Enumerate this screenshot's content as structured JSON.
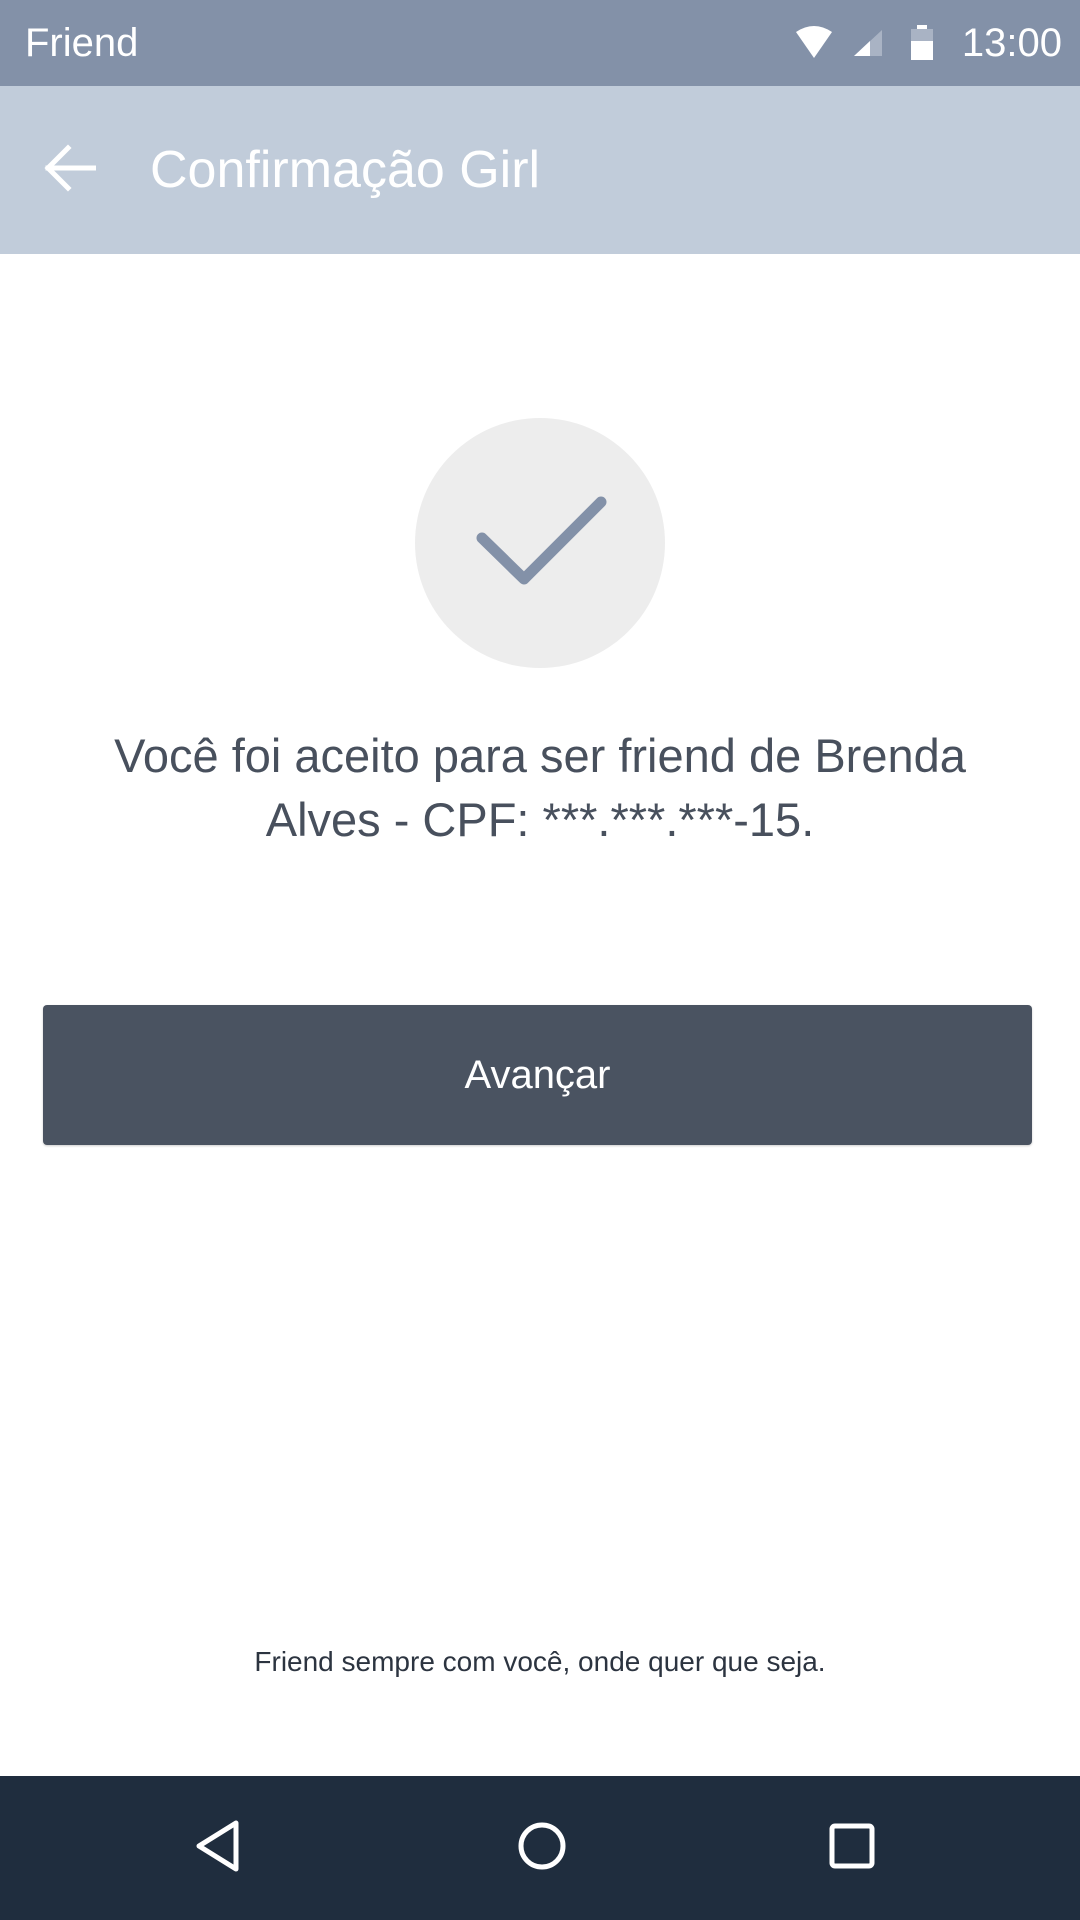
{
  "status_bar": {
    "app_name": "Friend",
    "time": "13:00",
    "icons": [
      "wifi-icon",
      "signal-icon",
      "battery-icon"
    ]
  },
  "app_bar": {
    "title": "Confirmação Girl",
    "back_icon": "arrow-left-icon"
  },
  "content": {
    "status_icon": "check-icon",
    "message": "Você foi aceito para ser friend de Brenda Alves - CPF: ***.***.***-15.",
    "primary_button_label": "Avançar",
    "footer_tagline": "Friend sempre com você, onde quer que seja."
  },
  "nav_bar": {
    "icons": [
      "back-triangle-icon",
      "home-circle-icon",
      "recents-square-icon"
    ]
  },
  "colors": {
    "status_bar": "#8391a8",
    "app_bar": "#c1ccda",
    "button": "#4a5361",
    "text": "#48505d",
    "check": "#8391a8",
    "nav_bar": "#1f2d3e"
  }
}
